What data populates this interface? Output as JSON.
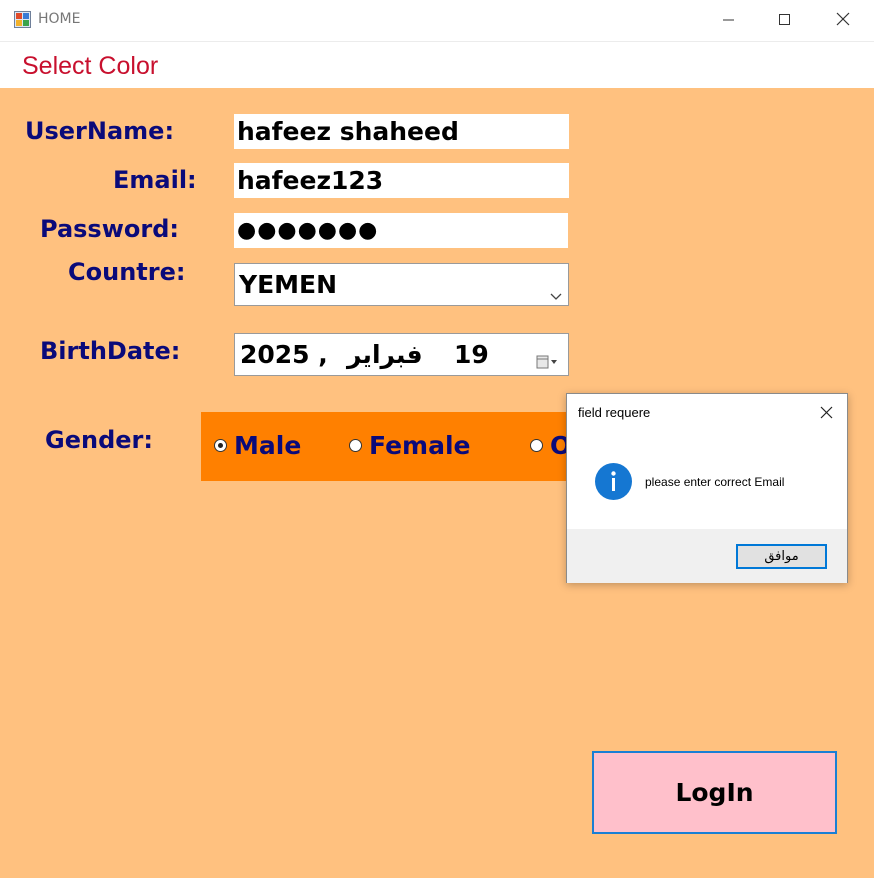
{
  "window": {
    "title": "HOME",
    "app_icon": "app-icon",
    "controls": [
      "minimize-icon",
      "maximize-icon",
      "close-icon"
    ]
  },
  "menu": {
    "items": [
      "Select Color"
    ]
  },
  "form": {
    "username_label": "UserName:",
    "username_value": "hafeez shaheed",
    "email_label": "Email:",
    "email_value": "hafeez123",
    "password_label": "Password:",
    "password_value": "●●●●●●●",
    "country_label": "Countre:",
    "country_value": "YEMEN",
    "birthdate_label": "BirthDate:",
    "birthdate_day": "19",
    "birthdate_month": "فبراير",
    "birthdate_year": "2025 ,",
    "gender_label": "Gender:",
    "gender_options": [
      {
        "label": "Male",
        "checked": true
      },
      {
        "label": "Female",
        "checked": false
      },
      {
        "label": "O",
        "checked": false
      }
    ],
    "login_label": "LogIn"
  },
  "message_box": {
    "title": "field requere",
    "icon": "info-icon",
    "text": "please enter correct Email",
    "ok_label": "موافق"
  },
  "colors": {
    "client_bg": "#ffc17f",
    "gender_panel_bg": "#ff8000",
    "label_color": "#0a0a7a",
    "menu_text": "#c8102e",
    "login_bg": "#ffc0cb",
    "accent_border": "#0078d7"
  }
}
